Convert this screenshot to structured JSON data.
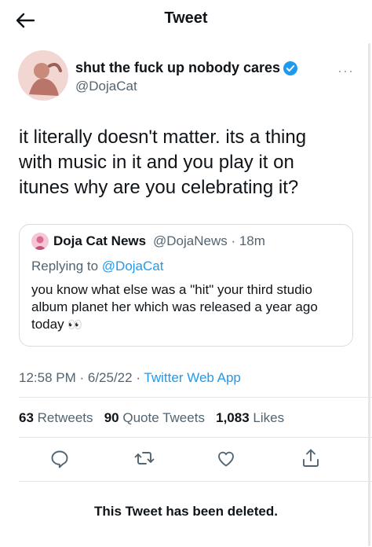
{
  "header": {
    "title": "Tweet"
  },
  "tweet": {
    "display_name": "shut the fuck up nobody cares",
    "handle": "@DojaCat",
    "text_lines": [
      "it literally doesn't matter. its a thing",
      "with music in it and you play it on",
      "itunes why are you celebrating it?"
    ],
    "time": "12:58 PM",
    "date": "6/25/22",
    "separator": " · ",
    "app": "Twitter Web App"
  },
  "quote": {
    "name": "Doja Cat News",
    "handle": "@DojaNews",
    "age": "18m",
    "replying_to_label": "Replying to ",
    "replying_to_handle": "@DojaCat",
    "text_lines": [
      "you know what else was a \"hit\" your third studio",
      "album planet her which was released a year ago",
      "today"
    ],
    "emoji": "👀"
  },
  "stats": {
    "retweets_count": "63",
    "retweets_label": "Retweets",
    "quote_count": "90",
    "quote_label": "Quote Tweets",
    "likes_count": "1,083",
    "likes_label": "Likes"
  },
  "actions": [
    "reply-icon",
    "retweet-icon",
    "like-icon",
    "share-icon"
  ],
  "footer": {
    "deleted_notice": "This Tweet has been deleted."
  },
  "colors": {
    "accent": "#1d9bf0",
    "muted": "#536471",
    "border": "#d6dde2"
  }
}
